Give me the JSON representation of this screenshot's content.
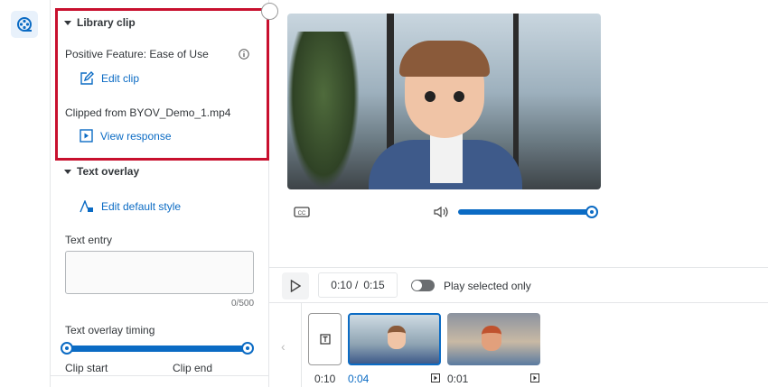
{
  "library_clip": {
    "title": "Library clip",
    "clip_name": "Positive Feature: Ease of Use",
    "edit_clip": "Edit clip",
    "clipped_from": "Clipped from BYOV_Demo_1.mp4",
    "view_response": "View response"
  },
  "text_overlay": {
    "title": "Text overlay",
    "edit_style": "Edit default style",
    "text_entry_label": "Text entry",
    "text_entry_value": "",
    "char_count": "0/500",
    "timing_label": "Text overlay timing",
    "clip_start": "Clip start",
    "clip_end": "Clip end",
    "timing_range": [
      0,
      1
    ]
  },
  "player": {
    "volume_percent": 100,
    "current_time": "0:10 /",
    "total_time": "0:15",
    "play_selected_label": "Play selected only",
    "play_selected_on": false
  },
  "timeline": {
    "items": [
      {
        "type": "text",
        "duration": "0:10"
      },
      {
        "type": "video",
        "duration": "0:04",
        "selected": true
      },
      {
        "type": "video",
        "duration": "0:01",
        "selected": false
      }
    ]
  },
  "colors": {
    "accent": "#0b6bc4",
    "highlight": "#c8102e"
  }
}
